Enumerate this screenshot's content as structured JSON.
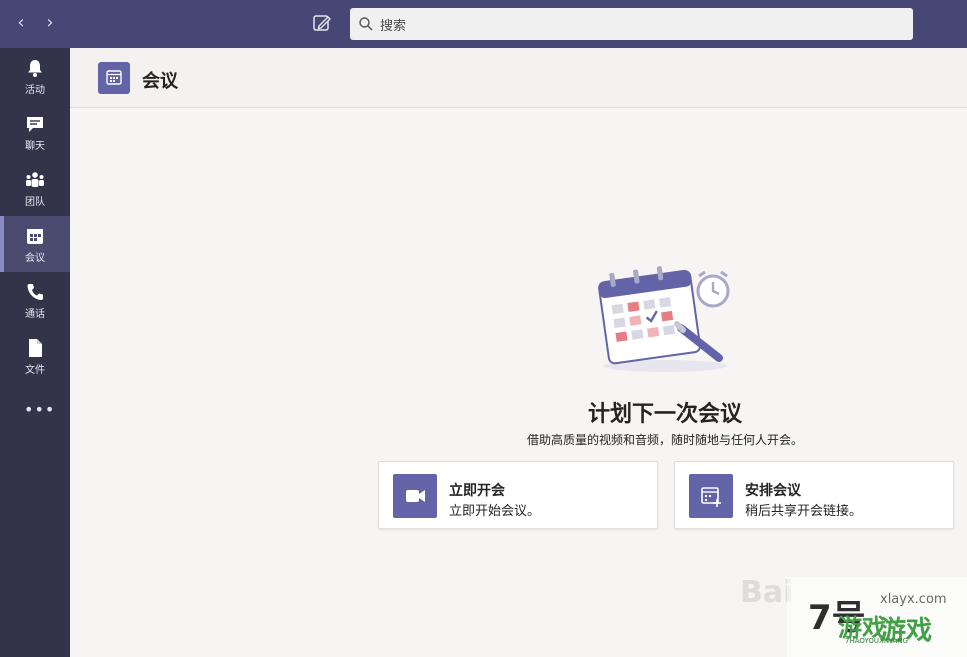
{
  "topbar": {
    "back_arrow": "‹",
    "forward_arrow": "›",
    "search_placeholder": "搜索"
  },
  "rail": {
    "items": [
      {
        "label": "活动",
        "icon": "bell-icon"
      },
      {
        "label": "聊天",
        "icon": "chat-icon"
      },
      {
        "label": "团队",
        "icon": "teams-icon"
      },
      {
        "label": "会议",
        "icon": "calendar-icon",
        "active": true
      },
      {
        "label": "通话",
        "icon": "phone-icon"
      },
      {
        "label": "文件",
        "icon": "file-icon"
      }
    ],
    "more": "•••"
  },
  "header": {
    "title": "会议"
  },
  "main": {
    "title": "计划下一次会议",
    "subtitle": "借助高质量的视频和音频，随时随地与任何人开会。",
    "cards": [
      {
        "title": "立即开会",
        "desc": "立即开始会议。",
        "icon": "video-camera-icon"
      },
      {
        "title": "安排会议",
        "desc": "稍后共享开会链接。",
        "icon": "calendar-add-icon"
      }
    ]
  },
  "watermark": {
    "baidu": "Bai",
    "site_num": "7号",
    "url": "xlayx.com",
    "cn1": "游戏",
    "cn2": "游戏",
    "pinyin": "7HAOYOUXIWANG"
  },
  "colors": {
    "topbar": "#464775",
    "rail": "#33344a",
    "accent": "#6264a7"
  }
}
